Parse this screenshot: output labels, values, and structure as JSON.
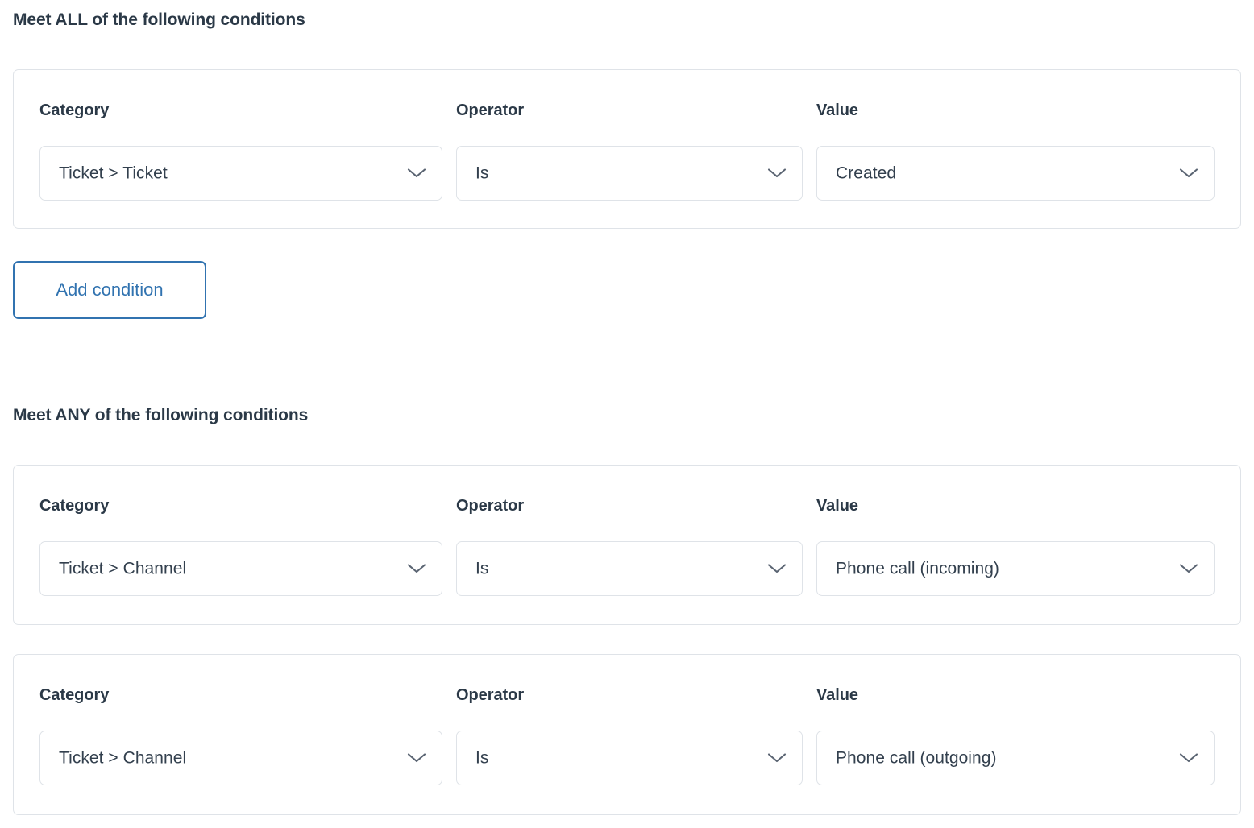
{
  "sections": [
    {
      "heading": "Meet ALL of the following conditions",
      "cards": [
        {
          "category_label": "Category",
          "operator_label": "Operator",
          "value_label": "Value",
          "category_value": "Ticket > Ticket",
          "operator_value": "Is",
          "value_value": "Created"
        }
      ],
      "add_button_label": "Add condition"
    },
    {
      "heading": "Meet ANY of the following conditions",
      "cards": [
        {
          "category_label": "Category",
          "operator_label": "Operator",
          "value_label": "Value",
          "category_value": "Ticket > Channel",
          "operator_value": "Is",
          "value_value": "Phone call (incoming)"
        },
        {
          "category_label": "Category",
          "operator_label": "Operator",
          "value_label": "Value",
          "category_value": "Ticket > Channel",
          "operator_value": "Is",
          "value_value": "Phone call (outgoing)"
        }
      ]
    }
  ],
  "icons": {
    "chevron": "chevron-down-icon"
  },
  "colors": {
    "accent_blue": "#3173b0",
    "text_dark": "#2b3947",
    "border_gray": "#dfe3e8",
    "chevron_gray": "#5a6472",
    "background": "#ffffff"
  }
}
